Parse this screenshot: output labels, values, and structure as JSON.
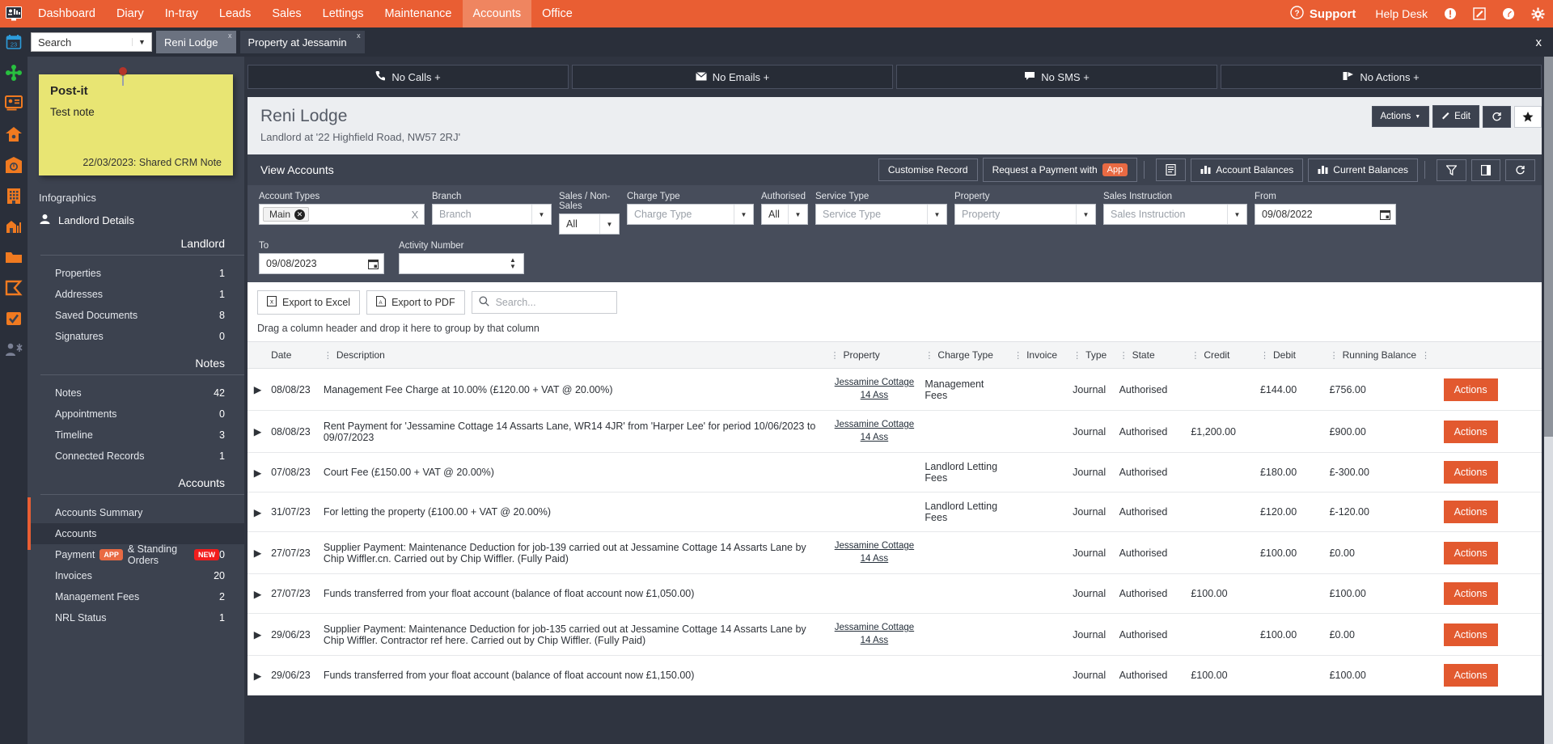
{
  "topnav": {
    "logo_icon": "dashboard-logo-icon",
    "items": [
      {
        "label": "Dashboard",
        "active": false
      },
      {
        "label": "Diary",
        "active": false
      },
      {
        "label": "In-tray",
        "active": false
      },
      {
        "label": "Leads",
        "active": false
      },
      {
        "label": "Sales",
        "active": false
      },
      {
        "label": "Lettings",
        "active": false
      },
      {
        "label": "Maintenance",
        "active": false
      },
      {
        "label": "Accounts",
        "active": true
      },
      {
        "label": "Office",
        "active": false
      }
    ],
    "support_label": "Support",
    "helpdesk_label": "Help Desk",
    "accent_color": "#e95e33"
  },
  "tabbar": {
    "search_placeholder": "Search",
    "tabs": [
      {
        "label": "Reni Lodge",
        "close": "x",
        "active": true
      },
      {
        "label": "Property at Jessamin",
        "close": "x",
        "active": false
      }
    ],
    "close_all": "x"
  },
  "iconrail": [
    "calendar-icon",
    "network-icon",
    "contact-card-icon",
    "house-icon",
    "property-clock-icon",
    "building-icon",
    "shop-chart-icon",
    "folder-icon",
    "flag-icon",
    "check-board-icon",
    "people-settings-icon"
  ],
  "postit": {
    "title": "Post-it",
    "body": "Test note",
    "footer": "22/03/2023: Shared CRM Note"
  },
  "sidebar": {
    "infographics_label": "Infographics",
    "landlord_details_label": "Landlord Details",
    "sections": [
      {
        "heading": "Landlord",
        "items": [
          {
            "label": "Properties",
            "count": "1"
          },
          {
            "label": "Addresses",
            "count": "1"
          },
          {
            "label": "Saved Documents",
            "count": "8"
          },
          {
            "label": "Signatures",
            "count": "0"
          }
        ]
      },
      {
        "heading": "Notes",
        "items": [
          {
            "label": "Notes",
            "count": "42"
          },
          {
            "label": "Appointments",
            "count": "0"
          },
          {
            "label": "Timeline",
            "count": "3"
          },
          {
            "label": "Connected Records",
            "count": "1"
          }
        ]
      },
      {
        "heading": "Accounts",
        "items": [
          {
            "label": "Accounts Summary",
            "count": ""
          },
          {
            "label": "Accounts",
            "count": "",
            "selected": true
          },
          {
            "label": "Payment",
            "count": "0",
            "badge_app": "APP",
            "label2": "& Standing Orders",
            "badge_new": "NEW"
          },
          {
            "label": "Invoices",
            "count": "20"
          },
          {
            "label": "Management Fees",
            "count": "2"
          },
          {
            "label": "NRL Status",
            "count": "1"
          }
        ]
      }
    ]
  },
  "comm_buttons": [
    {
      "label": "No Calls +",
      "icon": "phone-icon"
    },
    {
      "label": "No Emails +",
      "icon": "envelope-icon"
    },
    {
      "label": "No SMS +",
      "icon": "chat-icon"
    },
    {
      "label": "No Actions +",
      "icon": "actions-icon"
    }
  ],
  "record": {
    "title": "Reni Lodge",
    "subtitle": "Landlord at '22 Highfield Road, NW57 2RJ'",
    "actions_label": "Actions",
    "edit_label": "Edit",
    "refresh_icon": "refresh-icon",
    "star_icon": "star-icon"
  },
  "viewbar": {
    "title": "View Accounts",
    "customise_label": "Customise Record",
    "request_payment_label": "Request a Payment with",
    "request_payment_badge": "App",
    "report_icon": "report-icon",
    "account_balances_label": "Account Balances",
    "current_balances_label": "Current Balances",
    "filter_icon": "funnel-icon",
    "column_icon": "column-icon",
    "reload_icon": "reload-icon"
  },
  "filters": {
    "row1": [
      {
        "name": "account-types",
        "label": "Account Types",
        "type": "chips",
        "chip": "Main",
        "clear": "X"
      },
      {
        "name": "branch",
        "label": "Branch",
        "type": "select",
        "placeholder": "Branch",
        "value": ""
      },
      {
        "name": "sales-non-sales",
        "label": "Sales / Non-Sales",
        "type": "select",
        "value": "All"
      },
      {
        "name": "charge-type",
        "label": "Charge Type",
        "type": "select",
        "placeholder": "Charge Type",
        "value": ""
      },
      {
        "name": "authorised",
        "label": "Authorised",
        "type": "select",
        "value": "All"
      },
      {
        "name": "service-type",
        "label": "Service Type",
        "type": "select",
        "placeholder": "Service Type",
        "value": ""
      },
      {
        "name": "property",
        "label": "Property",
        "type": "select",
        "placeholder": "Property",
        "value": ""
      },
      {
        "name": "sales-instruction",
        "label": "Sales Instruction",
        "type": "select",
        "placeholder": "Sales Instruction",
        "value": ""
      },
      {
        "name": "from-date",
        "label": "From",
        "type": "date",
        "value": "09/08/2022"
      }
    ],
    "row2": [
      {
        "name": "to-date",
        "label": "To",
        "type": "date",
        "value": "09/08/2023"
      },
      {
        "name": "activity-number",
        "label": "Activity Number",
        "type": "number",
        "value": ""
      }
    ]
  },
  "gridtools": {
    "export_excel": "Export to Excel",
    "export_pdf": "Export to PDF",
    "search_placeholder": "Search...",
    "group_hint": "Drag a column header and drop it here to group by that column"
  },
  "table": {
    "columns": [
      "Date",
      "Description",
      "Property",
      "Charge Type",
      "Invoice",
      "Type",
      "State",
      "Credit",
      "Debit",
      "Running Balance"
    ],
    "actions_label": "Actions",
    "rows": [
      {
        "date": "08/08/23",
        "description": "Management Fee Charge at 10.00% (£120.00 + VAT @ 20.00%)",
        "property": "Jessamine Cottage 14 Ass",
        "charge_type": "Management Fees",
        "invoice": "",
        "type": "Journal",
        "state": "Authorised",
        "credit": "",
        "debit": "£144.00",
        "running_balance": "£756.00"
      },
      {
        "date": "08/08/23",
        "description": "Rent Payment for 'Jessamine Cottage 14 Assarts Lane, WR14 4JR' from 'Harper Lee' for period 10/06/2023 to 09/07/2023",
        "property": "Jessamine Cottage 14 Ass",
        "charge_type": "",
        "invoice": "",
        "type": "Journal",
        "state": "Authorised",
        "credit": "£1,200.00",
        "debit": "",
        "running_balance": "£900.00"
      },
      {
        "date": "07/08/23",
        "description": "Court Fee (£150.00 + VAT @ 20.00%)",
        "property": "",
        "charge_type": "Landlord Letting Fees",
        "invoice": "",
        "type": "Journal",
        "state": "Authorised",
        "credit": "",
        "debit": "£180.00",
        "running_balance": "£-300.00"
      },
      {
        "date": "31/07/23",
        "description": "For letting the property (£100.00 + VAT @ 20.00%)",
        "property": "",
        "charge_type": "Landlord Letting Fees",
        "invoice": "",
        "type": "Journal",
        "state": "Authorised",
        "credit": "",
        "debit": "£120.00",
        "running_balance": "£-120.00"
      },
      {
        "date": "27/07/23",
        "description": "Supplier Payment: Maintenance Deduction for job-139 carried out at Jessamine Cottage 14 Assarts Lane by Chip Wiffler.cn. Carried out by Chip Wiffler. (Fully Paid)",
        "property": "Jessamine Cottage 14 Ass",
        "charge_type": "",
        "invoice": "",
        "type": "Journal",
        "state": "Authorised",
        "credit": "",
        "debit": "£100.00",
        "running_balance": "£0.00"
      },
      {
        "date": "27/07/23",
        "description": "Funds transferred from your float account (balance of float account now £1,050.00)",
        "property": "",
        "charge_type": "",
        "invoice": "",
        "type": "Journal",
        "state": "Authorised",
        "credit": "£100.00",
        "debit": "",
        "running_balance": "£100.00"
      },
      {
        "date": "29/06/23",
        "description": "Supplier Payment: Maintenance Deduction for job-135 carried out at Jessamine Cottage 14 Assarts Lane by Chip Wiffler. Contractor ref here. Carried out by Chip Wiffler. (Fully Paid)",
        "property": "Jessamine Cottage 14 Ass",
        "charge_type": "",
        "invoice": "",
        "type": "Journal",
        "state": "Authorised",
        "credit": "",
        "debit": "£100.00",
        "running_balance": "£0.00"
      },
      {
        "date": "29/06/23",
        "description": "Funds transferred from your float account (balance of float account now £1,150.00)",
        "property": "",
        "charge_type": "",
        "invoice": "",
        "type": "Journal",
        "state": "Authorised",
        "credit": "£100.00",
        "debit": "",
        "running_balance": "£100.00"
      }
    ]
  }
}
